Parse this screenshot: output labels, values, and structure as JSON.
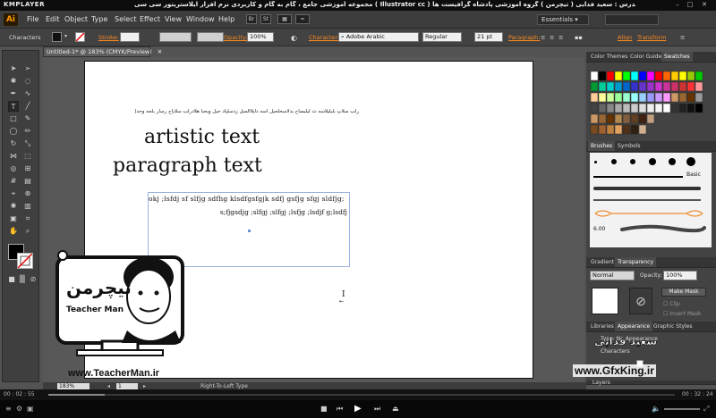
{
  "kmplayer": {
    "logo": "KMPLAYER",
    "title": "مجموعه آموزشی جامع ، گام به گام و کاربردی نرم افزار ایلاستریتور سی سی ( Illustrator cc )   مدرس : سعید فدایی ( تیچرمن ) گروه آموزشی پادشاه گرافیست ها",
    "time_current": "00 : 02 : 55",
    "time_total": "00 : 32 : 24",
    "seek_progress": 0.09
  },
  "menubar": {
    "logo": "Ai",
    "items": [
      "File",
      "Edit",
      "Object",
      "Type",
      "Select",
      "Effect",
      "View",
      "Window",
      "Help"
    ],
    "br_label": "Br",
    "st_label": "St",
    "workspace": "Essentials"
  },
  "control": {
    "panel_name": "Characters",
    "stroke_label": "Stroke:",
    "opacity_label": "Opacity:",
    "opacity_value": "100%",
    "character_label": "Character:",
    "font_value": "Adobe Arabic",
    "style_value": "Regular",
    "size_value": "21 pt",
    "paragraph_label": "Paragraph:",
    "align_label": "Align",
    "transform_label": "Transform"
  },
  "document": {
    "tab_title": "Untitled-1* @ 183% (CMYK/Preview)",
    "arabic_line": "رلب سلاپ بلبلیلاسه ت لیلبساح بدلاسحلحیل اسه داپلاالسل زدسلپاد حیل وبحبا هلادرلب سلاپاح رسار بلحه وحدل حیا لب رمابد",
    "artistic_text": "artistic text",
    "paragraph_text": "paragraph text",
    "para_line1": "okj ;lsfdj sf slfjg sdfhg klsdfgsfgjk sdfj gsfjg sfgj sldfjg;",
    "para_line2": "s;fjgsdjg ;slfgj ;slfgj ;lsfjg ;lsdjf g;lsdfj"
  },
  "status": {
    "zoom": "183%",
    "artboard_num": "1",
    "mode_text": "Right-To-Left Type"
  },
  "panels": {
    "tabs_top": [
      "Color Themes",
      "Color Guide",
      "Swatches"
    ],
    "tabs_brush": [
      "Brushes",
      "Symbols"
    ],
    "brush_basic": "Basic",
    "brush_size": "6.00",
    "tabs_gradient": [
      "Gradient",
      "Transparency"
    ],
    "blend_mode": "Normal",
    "opacity_label": "Opacity:",
    "opacity_value": "100%",
    "make_mask": "Make Mask",
    "clip": "Clip",
    "invert_mask": "Invert Mask",
    "tabs_appearance": [
      "Libraries",
      "Appearance",
      "Graphic Styles"
    ],
    "appearance_type": "Type: No Appearance",
    "appearance_chars": "Characters",
    "layers": "Layers"
  },
  "watermarks": {
    "teacherman_url": "www.TeacherMan.ir",
    "teacherman_name": "Teacher Man",
    "teacherman_fa": "تیچرمن",
    "gfxking_url": "www.GfxKing.ir",
    "gfxking_name": "سعید فدایی"
  },
  "colors": {
    "accent": "#ff8a1c",
    "ai_orange": "#ff9a00",
    "selection_blue": "#6c8fd6"
  }
}
